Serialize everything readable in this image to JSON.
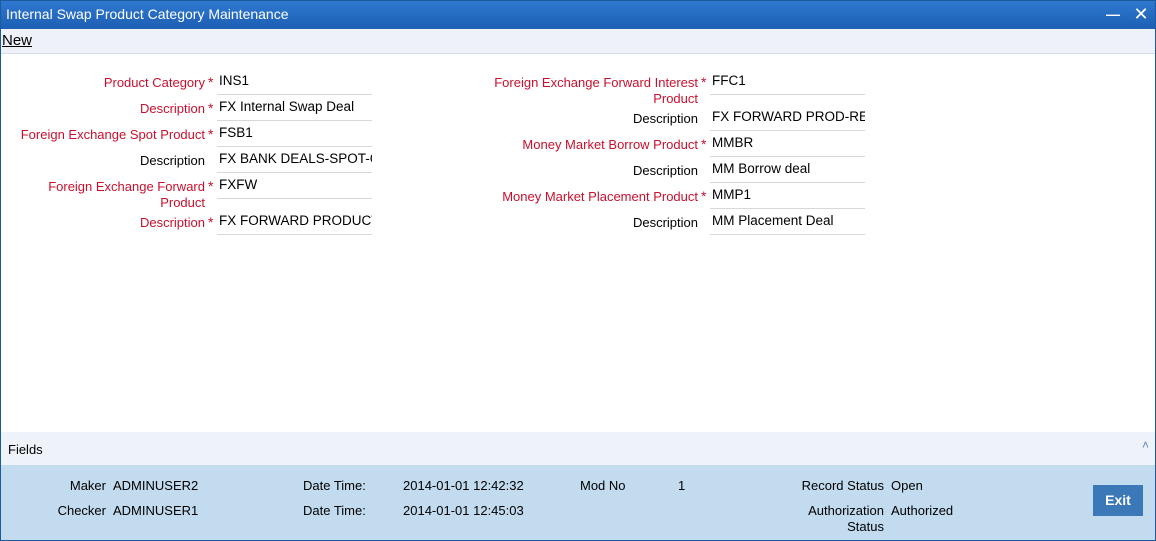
{
  "window": {
    "title": "Internal Swap Product Category Maintenance",
    "minimize_glyph": "—",
    "close_glyph": "✕"
  },
  "menu": {
    "new_label": "New"
  },
  "required_marker": "*",
  "left_fields": [
    {
      "label": "Product Category",
      "value": "INS1"
    },
    {
      "label": "Description",
      "value": "FX Internal Swap Deal"
    },
    {
      "label": "Foreign Exchange Spot Product",
      "value": "FSB1"
    },
    {
      "label": "Description",
      "value": "FX BANK DEALS-SPOT-C"
    },
    {
      "label": "Foreign Exchange Forward Product",
      "value": "FXFW"
    },
    {
      "label": "Description",
      "value": "FX FORWARD PRODUCT"
    }
  ],
  "right_fields": [
    {
      "label": "Foreign Exchange Forward Interest Product",
      "value": "FFC1"
    },
    {
      "label": "Description",
      "value": "FX FORWARD PROD-RE"
    },
    {
      "label": "Money Market Borrow Product",
      "value": "MMBR"
    },
    {
      "label": "Description",
      "value": "MM Borrow deal"
    },
    {
      "label": "Money Market Placement Product",
      "value": "MMP1"
    },
    {
      "label": "Description",
      "value": "MM Placement Deal"
    }
  ],
  "fields_section": {
    "label": "Fields",
    "caret_glyph": "˄"
  },
  "footer": {
    "maker_label": "Maker",
    "maker_value": "ADMINUSER2",
    "checker_label": "Checker",
    "checker_value": "ADMINUSER1",
    "maker_datetime_label": "Date Time:",
    "maker_datetime_value": "2014-01-01 12:42:32",
    "checker_datetime_label": "Date Time:",
    "checker_datetime_value": "2014-01-01 12:45:03",
    "mod_no_label": "Mod No",
    "mod_no_value": "1",
    "record_status_label": "Record Status",
    "record_status_value": "Open",
    "auth_status_label_1": "Authorization",
    "auth_status_label_2": "Status",
    "auth_status_value": "Authorized",
    "exit_label": "Exit"
  }
}
